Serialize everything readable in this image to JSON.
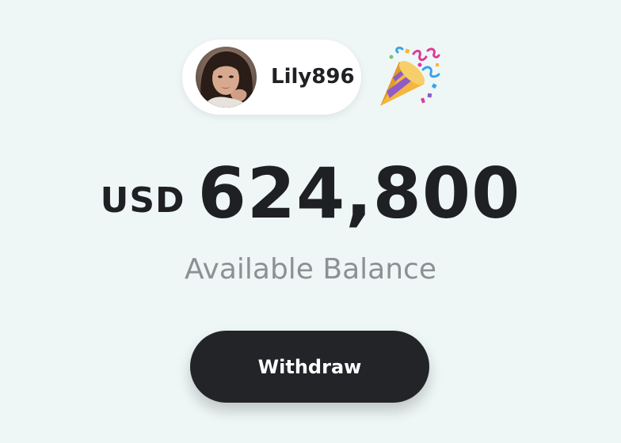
{
  "user": {
    "username": "Lily896",
    "avatar_icon": "user-avatar-photo",
    "celebration_icon": "party-popper-icon"
  },
  "balance": {
    "currency": "USD",
    "amount": "624,800",
    "label": "Available Balance"
  },
  "actions": {
    "withdraw_label": "Withdraw"
  },
  "colors": {
    "background": "#eef7f6",
    "button": "#232427",
    "text_primary": "#1f2023",
    "text_secondary": "#8d9095"
  }
}
